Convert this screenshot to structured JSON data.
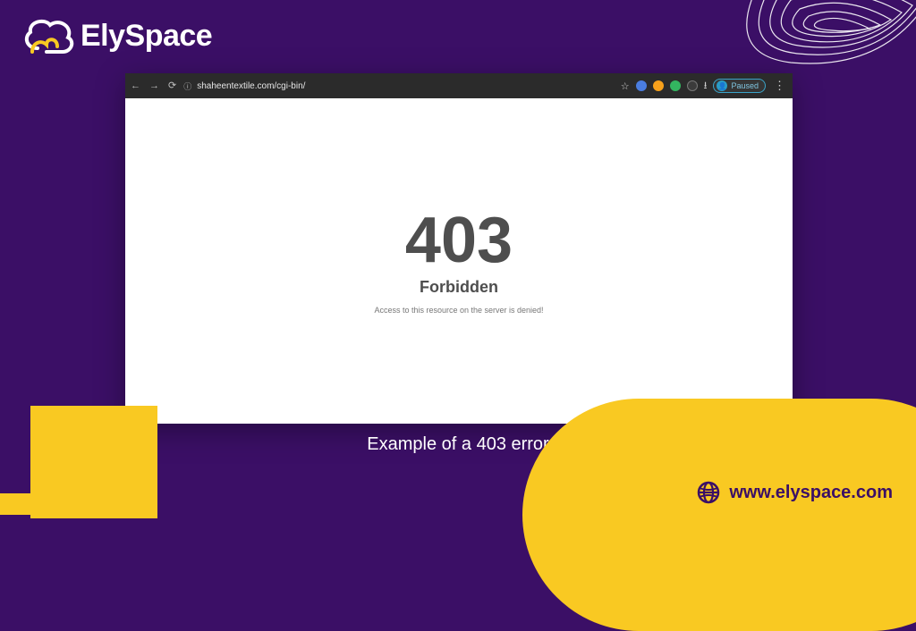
{
  "brand": {
    "name": "ElySpace"
  },
  "browser": {
    "url": "shaheentextile.com/cgi-bin/",
    "paused_label": "Paused"
  },
  "error": {
    "code": "403",
    "title": "Forbidden",
    "message": "Access to this resource on the server is denied!"
  },
  "caption": "Example of a 403 error",
  "footer": {
    "url": "www.elyspace.com"
  },
  "colors": {
    "background": "#3B0F66",
    "accent": "#F9C922"
  }
}
